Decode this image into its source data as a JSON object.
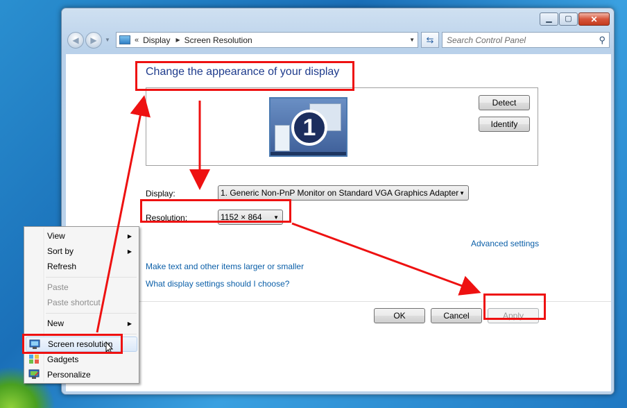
{
  "window": {
    "minimize_icon": "minimize-icon",
    "maximize_icon": "maximize-icon",
    "close_icon": "close-icon"
  },
  "nav": {
    "address": {
      "overflow": "«",
      "crumbs": [
        "Display",
        "Screen Resolution"
      ]
    },
    "search_placeholder": "Search Control Panel"
  },
  "content": {
    "heading": "Change the appearance of your display",
    "monitor_number": "1",
    "detect_label": "Detect",
    "identify_label": "Identify",
    "display_label": "Display:",
    "display_value": "1. Generic Non-PnP Monitor on Standard VGA Graphics Adapter",
    "resolution_label": "Resolution:",
    "resolution_value": "1152 × 864",
    "advanced_link": "Advanced settings",
    "link_text_size": "Make text and other items larger or smaller",
    "link_help": "What display settings should I choose?",
    "ok_label": "OK",
    "cancel_label": "Cancel",
    "apply_label": "Apply"
  },
  "context_menu": {
    "items": [
      {
        "label": "View",
        "submenu": true,
        "disabled": false
      },
      {
        "label": "Sort by",
        "submenu": true,
        "disabled": false
      },
      {
        "label": "Refresh",
        "submenu": false,
        "disabled": false
      },
      {
        "label": "Paste",
        "submenu": false,
        "disabled": true
      },
      {
        "label": "Paste shortcut",
        "submenu": false,
        "disabled": true
      },
      {
        "label": "New",
        "submenu": true,
        "disabled": false
      },
      {
        "label": "Screen resolution",
        "submenu": false,
        "disabled": false,
        "highlighted": true
      },
      {
        "label": "Gadgets",
        "submenu": false,
        "disabled": false
      },
      {
        "label": "Personalize",
        "submenu": false,
        "disabled": false
      }
    ]
  },
  "colors": {
    "annotation_red": "#e11111",
    "heading_blue": "#1e3b8c",
    "link_blue": "#0b5fa8"
  }
}
